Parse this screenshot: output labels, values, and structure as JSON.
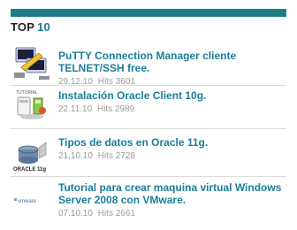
{
  "widget": {
    "heading_prefix": "TOP",
    "heading_number": "10"
  },
  "items": [
    {
      "title": "PuTTY Connection Manager cliente TELNET/SSH free.",
      "date": "29.12.10",
      "hits_label": "Hits",
      "hits": "3601",
      "icon": "putty-icon"
    },
    {
      "title": "Instalación Oracle Client 10g.",
      "date": "22.11.10",
      "hits_label": "Hits",
      "hits": "2989",
      "icon": "install-tutorial-icon",
      "thumb_caption": "TUTORIAL"
    },
    {
      "title": "Tipos de datos en Oracle 11g.",
      "date": "21.10.10",
      "hits_label": "Hits",
      "hits": "2728",
      "icon": "oracle-11g-logo-icon",
      "thumb_caption": "ORACLE 11g"
    },
    {
      "title": "Tutorial para crear maquina virtual Windows Server 2008 con VMware.",
      "date": "07.10.10",
      "hits_label": "Hits",
      "hits": "2661",
      "icon": "vmware-logo-icon",
      "thumb_caption": "vmware"
    }
  ],
  "colors": {
    "accent": "#1d7c86",
    "link": "#1a7e9a",
    "meta": "#9a9a9a"
  }
}
